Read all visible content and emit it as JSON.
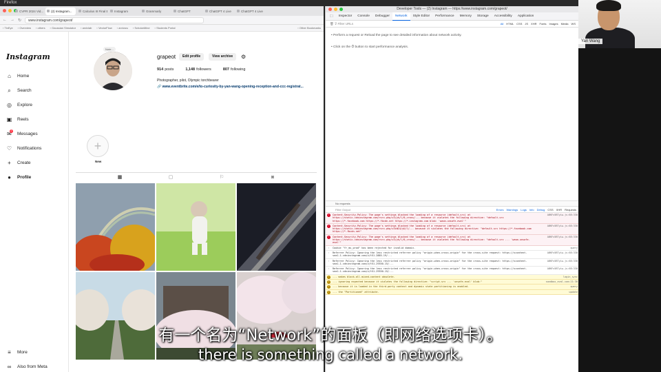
{
  "menubar": {
    "app": "Firefox"
  },
  "browser": {
    "tabs": [
      "CVPR 2024 Vid...",
      "(2) Instagram...",
      "Calculus III Final E...",
      "Instagram",
      "Grammarly",
      "ChatGPT",
      "ChatGPT 4 Live",
      "ChatGPT 4 Live"
    ],
    "url": "www.instagram.com/grapeot/",
    "bookmarks": [
      "TinEye",
      "Overview",
      "others",
      "Gaussian Simulator",
      "arxivlab",
      "VectorFlow",
      "arxivwu",
      "ScholarMine",
      "Students Portal"
    ],
    "other_bookmarks": "Other Bookmarks"
  },
  "instagram": {
    "logo": "Instagram",
    "nav": [
      {
        "label": "Home",
        "icon": "⌂"
      },
      {
        "label": "Search",
        "icon": "⌕"
      },
      {
        "label": "Explore",
        "icon": "◎"
      },
      {
        "label": "Reels",
        "icon": "▣"
      },
      {
        "label": "Messages",
        "icon": "✉"
      },
      {
        "label": "Notifications",
        "icon": "♡"
      },
      {
        "label": "Create",
        "icon": "+"
      },
      {
        "label": "Profile",
        "icon": "●"
      }
    ],
    "messages_badge": "2",
    "more": "More",
    "also_from_meta": "Also from Meta",
    "profile": {
      "note": "Note...",
      "username": "grapeot",
      "edit_profile": "Edit profile",
      "view_archive": "View archive",
      "posts_num": "914",
      "posts_label": "posts",
      "followers_num": "1,148",
      "followers_label": "followers",
      "following_num": "807",
      "following_label": "following",
      "bio": "Photographer, pilot, Olympic torchbearer",
      "link": "www.eventbrite.com/e/to-curiosity-by-yan-wang-opening-reception-and-ccc-registrat..."
    },
    "highlight_new": "New"
  },
  "devtools": {
    "title": "Developer Tools — (2) Instagram — https://www.instagram.com/grapeot/",
    "tabs": [
      "Inspector",
      "Console",
      "Debugger",
      "Network",
      "Style Editor",
      "Performance",
      "Memory",
      "Storage",
      "Accessibility",
      "Application"
    ],
    "filter_placeholder": "Filter URLs",
    "net_filters": [
      "All",
      "HTML",
      "CSS",
      "JS",
      "XHR",
      "Fonts",
      "Images",
      "Media",
      "WS"
    ],
    "msg1": "• Perform a request or  Reload  the page to see detailed information about network activity.",
    "msg2": "• Click on the  ⏱  button to start performance analysis.",
    "status": "No requests",
    "console_filter": "Filter Output",
    "console_levels": [
      "Errors",
      "Warnings",
      "Logs",
      "Info",
      "Debug",
      "CSS",
      "XHR",
      "Requests"
    ],
    "console_rows": [
      {
        "type": "error",
        "text": "Content-Security-Policy: The page's settings blocked the loading of a resource (default-src) at https://static.cdninstagram.com/rsrc.php/v3/yk/l/0,cross/... because it violates the following directive: \"default-src https://*.facebook.com https://*.fbcdn.net https://*.instagram.com blob: 'wasm-unsafe-eval'\"",
        "src": "ABKFx5BTyLw.js:68:338"
      },
      {
        "type": "error",
        "text": "Content-Security-Policy: The page's settings blocked the loading of a resource (default-src) at https://static.cdninstagram.com/rsrc.php/v3iWI4/yU/l/... because it violates the following directive: \"default-src https://*.facebook.com https://*.fbcdn.net\"",
        "src": "ABKFx5BTyLw.js:68:338"
      },
      {
        "type": "error",
        "text": "Content-Security-Policy: The page's settings blocked the loading of a resource (default-src) at https://static.cdninstagram.com/rsrc.php/v3/yk/l/0,cross/... because it violates the following directive: \"default-src ... 'wasm-unsafe-eval'\"",
        "src": "ABKFx5BTyLw.js:68:338"
      },
      {
        "type": "log",
        "text": "Cookie \"fr_ms_prod\" has been rejected for invalid domain.",
        "src": "query"
      },
      {
        "type": "log",
        "text": "Referrer Policy: Ignoring the less restricted referrer policy \"origin-when-cross-origin\" for the cross-site request: https://scontent-sea1-1.cdninstagram.com/v/t51.2885-19/...",
        "src": "ABKFx5BTyLw.js:68:338"
      },
      {
        "type": "log",
        "text": "Referrer Policy: Ignoring the less restricted referrer policy \"origin-when-cross-origin\" for the cross-site request: https://scontent-sea1-1.cdninstagram.com/v/t51.29350-15/...",
        "src": "ABKFx5BTyLw.js:68:338"
      },
      {
        "type": "log",
        "text": "Referrer Policy: Ignoring the less restricted referrer policy \"origin-when-cross-origin\" for the cross-site request: https://scontent-sea1-1.cdninstagram.com/v/t51.29350-15/...",
        "src": "ABKFx5BTyLw.js:68:338"
      },
      {
        "type": "warn",
        "text": "... makes block-all-mixed-content obsolete.",
        "src": "login_sync"
      },
      {
        "type": "warn",
        "text": "... ignoring expected because it violates the following directive: \"script-src ... 'unsafe-eval' blob:\"",
        "src": "sandbox_eval.com:21:38"
      },
      {
        "type": "warn",
        "text": "... because it is loaded in the third-party context and dynamic state partitioning is enabled.",
        "src": "query"
      },
      {
        "type": "warn",
        "text": "... the \"Partitioned\" attribute.",
        "src": "update"
      }
    ]
  },
  "webcam": {
    "name": "Yan Wang"
  },
  "subtitles": {
    "cn": "有一个名为“Network”的面板（即网络选项卡）。",
    "en": "there is something called a network."
  },
  "colors": {
    "devtools_accent": "#0060df",
    "error_bg": "#fdf2f5",
    "warn_bg": "#fffbd6",
    "ig_link": "#00376b"
  }
}
